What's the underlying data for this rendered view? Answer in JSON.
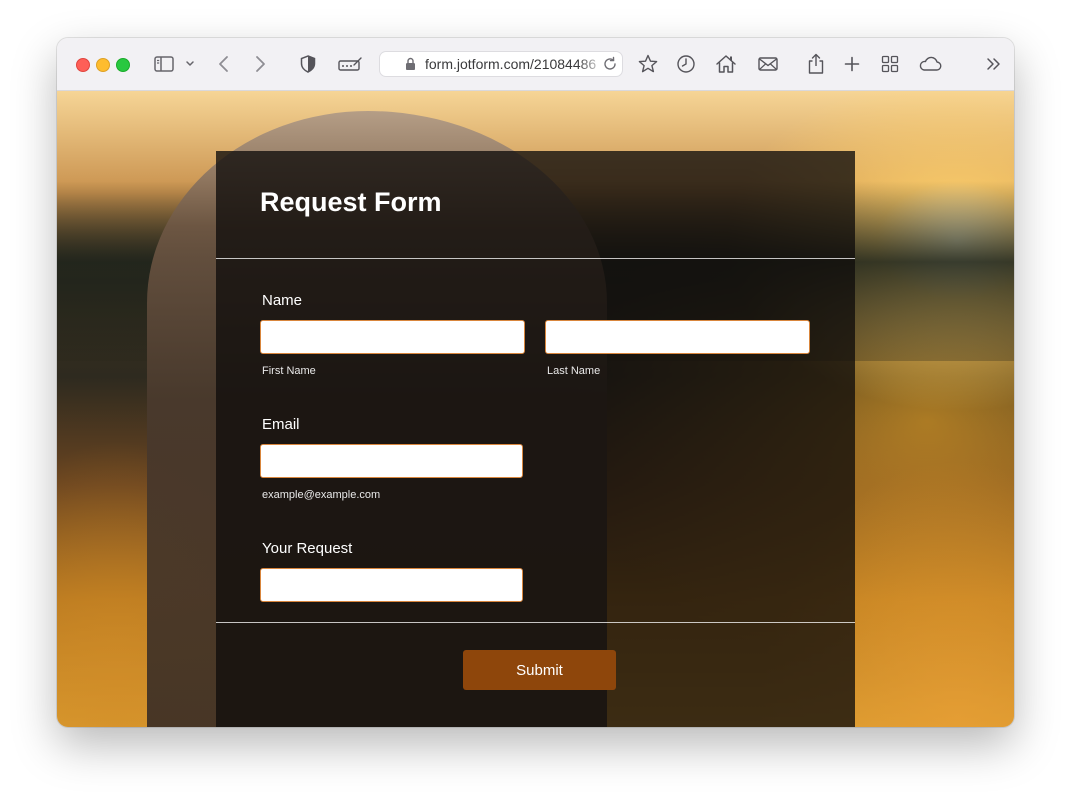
{
  "browser": {
    "url": "form.jotform.com/21084486"
  },
  "form": {
    "title": "Request Form",
    "name_label": "Name",
    "first_name_sublabel": "First Name",
    "last_name_sublabel": "Last Name",
    "first_name_value": "",
    "last_name_value": "",
    "email_label": "Email",
    "email_sublabel": "example@example.com",
    "email_value": "",
    "request_label": "Your Request",
    "request_value": "",
    "submit_label": "Submit"
  },
  "colors": {
    "submit": "#8e460b",
    "field_border": "#d9863d"
  },
  "icons": {
    "toolbar": [
      "sidebar-icon",
      "chevron-down-icon",
      "back-icon",
      "forward-icon",
      "shield-icon",
      "autofill-icon",
      "lock-icon",
      "reload-icon",
      "star-icon",
      "history-icon",
      "home-icon",
      "mail-icon",
      "share-icon",
      "plus-icon",
      "grid-icon",
      "cloud-icon",
      "overflow-icon"
    ]
  }
}
